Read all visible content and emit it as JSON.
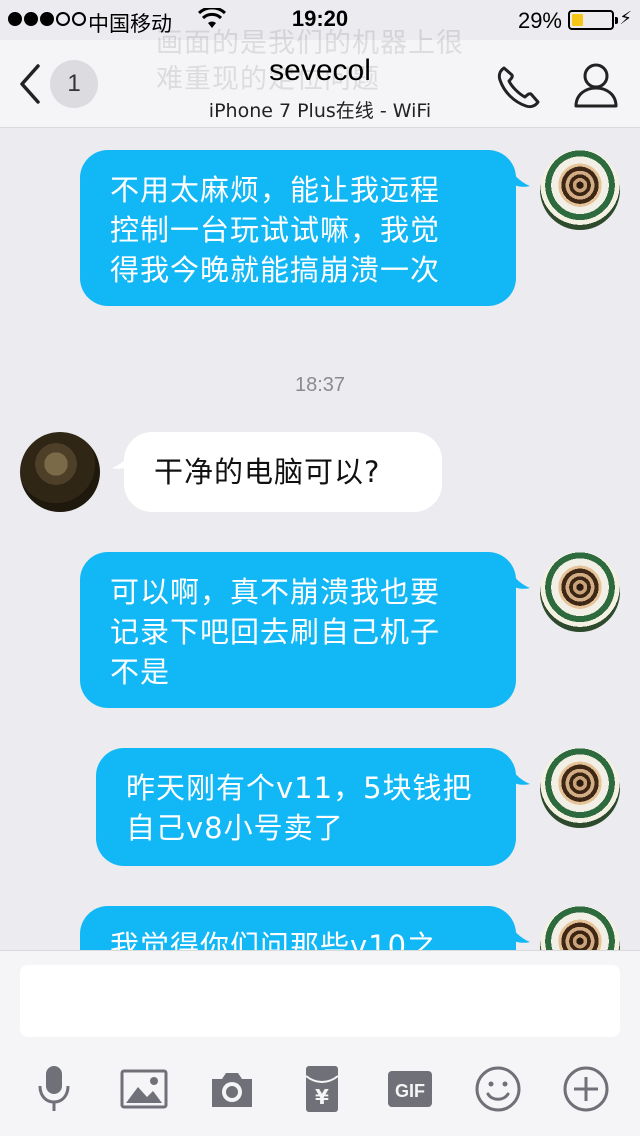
{
  "status_bar": {
    "carrier": "中国移动",
    "time": "19:20",
    "battery_percent": "29%",
    "battery_level": 0.29,
    "signal_bars_filled": 3,
    "signal_bars_total": 5
  },
  "header": {
    "ghost_text": [
      "画面的是我们的机器上很",
      "难重现的定位问题"
    ],
    "unread_count": "1",
    "title": "sevecol",
    "subtitle": "iPhone 7 Plus在线 - WiFi",
    "icons": [
      "back-icon",
      "phone-icon",
      "profile-icon"
    ]
  },
  "messages": [
    {
      "direction": "out",
      "text_lines": [
        "不用太麻烦，能让我远程",
        "控制一台玩试试嘛，我觉",
        "得我今晚就能搞崩溃一次"
      ]
    },
    {
      "type": "timestamp",
      "text": "18:37"
    },
    {
      "direction": "in",
      "text_lines": [
        "干净的电脑可以?"
      ]
    },
    {
      "direction": "out",
      "text_lines": [
        "可以啊，真不崩溃我也要",
        "记录下吧回去刷自己机子",
        "不是"
      ]
    },
    {
      "direction": "out",
      "text_lines": [
        "昨天刚有个v11，5块钱把",
        "自己v8小号卖了"
      ]
    },
    {
      "direction": "out",
      "text_lines": [
        "我觉得你们问那些v10之"
      ]
    }
  ],
  "input": {
    "value": "",
    "placeholder": ""
  },
  "toolbar": {
    "icons": [
      "microphone-icon",
      "image-icon",
      "camera-icon",
      "red-packet-icon",
      "gif-icon",
      "emoji-icon",
      "plus-icon"
    ],
    "gif_label": "GIF",
    "red_packet_symbol": "¥"
  },
  "colors": {
    "outgoing_bubble": "#12b7f5",
    "incoming_bubble": "#ffffff",
    "background": "#ebebf0",
    "icon_gray": "#707078"
  }
}
